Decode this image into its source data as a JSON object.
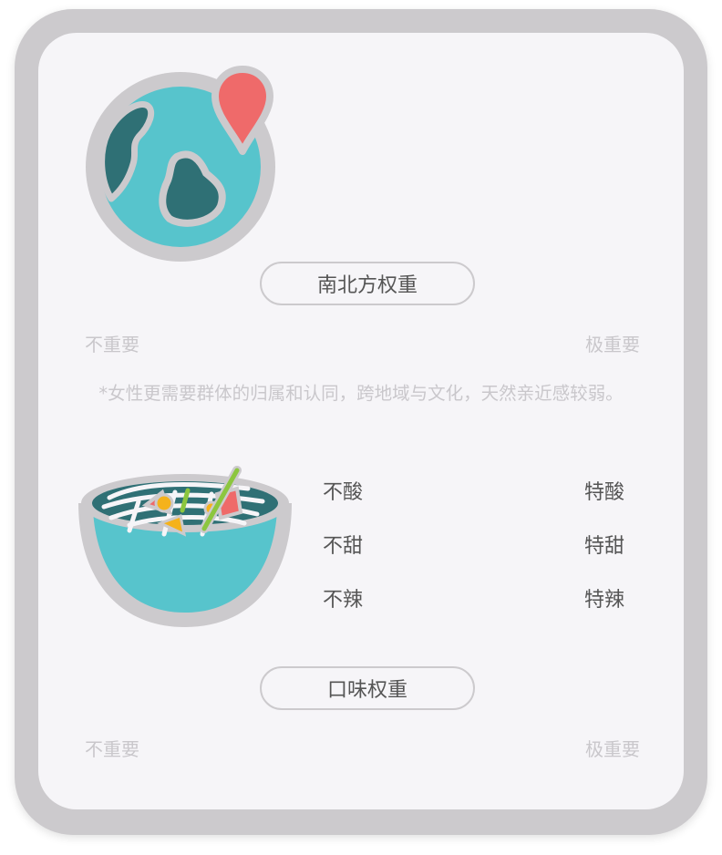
{
  "colors": {
    "teal": "#57c4cc",
    "dark_teal": "#2f7075",
    "red": "#ef6a6a",
    "yellow": "#f5b21b",
    "green": "#8cc63f",
    "outline_gray": "#cccacd",
    "panel_bg": "#f6f5f8"
  },
  "region": {
    "icon": "globe-pin-icon",
    "weight_button_label": "南北方权重",
    "scale_min_label": "不重要",
    "scale_max_label": "极重要",
    "note": "*女性更需要群体的归属和认同，跨地域与文化，天然亲近感较弱。"
  },
  "taste": {
    "icon": "noodle-bowl-icon",
    "options": [
      {
        "low": "不酸",
        "high": "特酸"
      },
      {
        "low": "不甜",
        "high": "特甜"
      },
      {
        "low": "不辣",
        "high": "特辣"
      }
    ],
    "weight_button_label": "口味权重",
    "scale_min_label": "不重要",
    "scale_max_label": "极重要"
  }
}
